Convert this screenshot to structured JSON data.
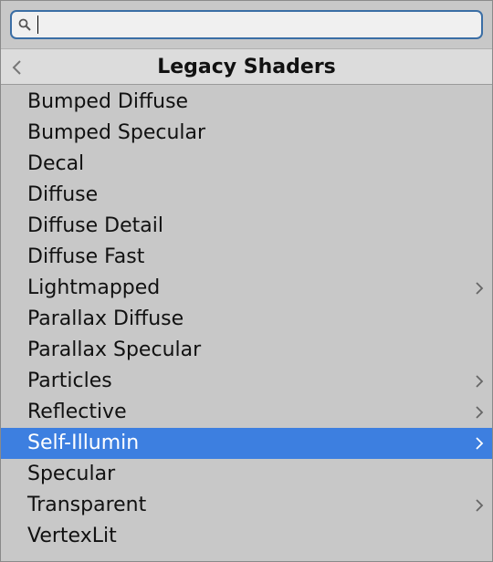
{
  "search": {
    "value": "",
    "placeholder": ""
  },
  "header": {
    "title": "Legacy Shaders"
  },
  "items": [
    {
      "label": "Bumped Diffuse",
      "submenu": false,
      "selected": false
    },
    {
      "label": "Bumped Specular",
      "submenu": false,
      "selected": false
    },
    {
      "label": "Decal",
      "submenu": false,
      "selected": false
    },
    {
      "label": "Diffuse",
      "submenu": false,
      "selected": false
    },
    {
      "label": "Diffuse Detail",
      "submenu": false,
      "selected": false
    },
    {
      "label": "Diffuse Fast",
      "submenu": false,
      "selected": false
    },
    {
      "label": "Lightmapped",
      "submenu": true,
      "selected": false
    },
    {
      "label": "Parallax Diffuse",
      "submenu": false,
      "selected": false
    },
    {
      "label": "Parallax Specular",
      "submenu": false,
      "selected": false
    },
    {
      "label": "Particles",
      "submenu": true,
      "selected": false
    },
    {
      "label": "Reflective",
      "submenu": true,
      "selected": false
    },
    {
      "label": "Self-Illumin",
      "submenu": true,
      "selected": true
    },
    {
      "label": "Specular",
      "submenu": false,
      "selected": false
    },
    {
      "label": "Transparent",
      "submenu": true,
      "selected": false
    },
    {
      "label": "VertexLit",
      "submenu": false,
      "selected": false
    }
  ],
  "colors": {
    "selection": "#3d7fe0",
    "background": "#c8c8c8",
    "header": "#dcdcdc",
    "search_border": "#3a6ea5"
  },
  "icons": {
    "search": "search-icon",
    "back": "chevron-left-icon",
    "submenu": "chevron-right-icon"
  }
}
